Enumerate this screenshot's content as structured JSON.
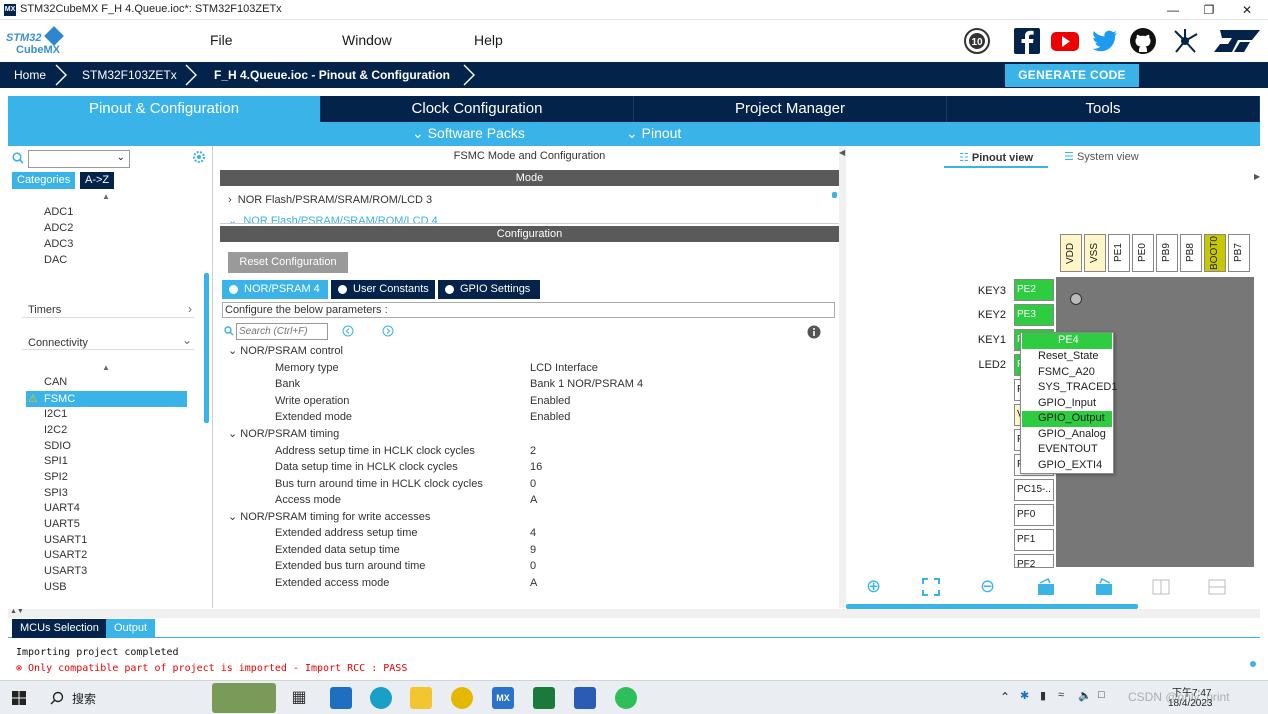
{
  "window": {
    "title": "STM32CubeMX F_H 4.Queue.ioc*: STM32F103ZETx",
    "app_icon": "MX",
    "controls": [
      "—",
      "❐",
      "✕"
    ]
  },
  "menubar": {
    "logo_line1": "STM32",
    "logo_line2": "CubeMX",
    "items": [
      "File",
      "Window",
      "Help"
    ],
    "badge": "10",
    "social_icons": [
      "anniversary-badge-icon",
      "facebook-icon",
      "youtube-icon",
      "twitter-icon",
      "github-icon",
      "network-icon",
      "st-logo-icon"
    ]
  },
  "breadcrumb": {
    "items": [
      "Home",
      "STM32F103ZETx",
      "F_H 4.Queue.ioc - Pinout & Configuration"
    ],
    "generate_label": "GENERATE CODE"
  },
  "main_tabs": [
    "Pinout & Configuration",
    "Clock Configuration",
    "Project Manager",
    "Tools"
  ],
  "sub_tabs": [
    "Software Packs",
    "Pinout"
  ],
  "left_panel": {
    "category_tabs": [
      "Categories",
      "A->Z"
    ],
    "analog_items": [
      "ADC1",
      "ADC2",
      "ADC3",
      "DAC"
    ],
    "timers_label": "Timers",
    "connectivity_label": "Connectivity",
    "connectivity_items": [
      "CAN",
      "FSMC",
      "I2C1",
      "I2C2",
      "SDIO",
      "SPI1",
      "SPI2",
      "SPI3",
      "UART4",
      "UART5",
      "USART1",
      "USART2",
      "USART3",
      "USB"
    ],
    "selected": "FSMC"
  },
  "center": {
    "title": "FSMC Mode and Configuration",
    "mode_header": "Mode",
    "mode_rows": [
      "NOR Flash/PSRAM/SRAM/ROM/LCD 3",
      "NOR Flash/PSRAM/SRAM/ROM/LCD 4"
    ],
    "config_header": "Configuration",
    "reset_button": "Reset Configuration",
    "config_tabs": [
      "NOR/PSRAM 4",
      "User Constants",
      "GPIO Settings"
    ],
    "params_hint": "Configure the below parameters :",
    "search_placeholder": "Search (Ctrl+F)",
    "groups": [
      {
        "name": "NOR/PSRAM control",
        "params": [
          {
            "k": "Memory type",
            "v": "LCD Interface"
          },
          {
            "k": "Bank",
            "v": "Bank 1 NOR/PSRAM 4"
          },
          {
            "k": "Write operation",
            "v": "Enabled"
          },
          {
            "k": "Extended mode",
            "v": "Enabled"
          }
        ]
      },
      {
        "name": "NOR/PSRAM timing",
        "params": [
          {
            "k": "Address setup time in HCLK clock cycles",
            "v": "2"
          },
          {
            "k": "Data setup time in HCLK clock cycles",
            "v": "16"
          },
          {
            "k": "Bus turn around time in HCLK clock cycles",
            "v": "0"
          },
          {
            "k": "Access mode",
            "v": "A"
          }
        ]
      },
      {
        "name": "NOR/PSRAM timing for write accesses",
        "params": [
          {
            "k": "Extended address setup time",
            "v": "4"
          },
          {
            "k": "Extended data setup time",
            "v": "9"
          },
          {
            "k": "Extended bus turn around time",
            "v": "0"
          },
          {
            "k": "Extended access mode",
            "v": "A"
          }
        ]
      }
    ]
  },
  "right": {
    "tabs": [
      "Pinout view",
      "System view"
    ],
    "top_pins": [
      "VDD",
      "VSS",
      "PE1",
      "PE0",
      "PB9",
      "PB8",
      "BOOT0",
      "PB7"
    ],
    "left_pins": [
      "PE2",
      "PE3",
      "P",
      "P",
      "P",
      "V",
      "P",
      "P",
      "P",
      "PC15-..",
      "PF0",
      "PF1",
      "PF2"
    ],
    "pin_labels": [
      "KEY3",
      "KEY2",
      "KEY1",
      "LED2"
    ],
    "context_menu": {
      "title": "PE4",
      "items": [
        "Reset_State",
        "FSMC_A20",
        "SYS_TRACED1",
        "GPIO_Input",
        "GPIO_Output",
        "GPIO_Analog",
        "EVENTOUT",
        "GPIO_EXTI4"
      ],
      "highlighted": "GPIO_Output"
    },
    "tool_icons": [
      "zoom-in-icon",
      "fit-icon",
      "zoom-out-icon",
      "rotate-right-icon",
      "rotate-left-icon",
      "split-icon",
      "list-icon"
    ]
  },
  "bottom": {
    "tabs": [
      "MCUs Selection",
      "Output"
    ],
    "lines": [
      "Importing project completed",
      "⊗ Only compatible part of project is imported - Import RCC : PASS"
    ]
  },
  "taskbar": {
    "search_label": "搜索",
    "time": "下午7:47",
    "date": "18/4/2023",
    "watermark": "CSDN @only_print"
  },
  "colors": {
    "navy": "#03234b",
    "accent": "#3ab3e9",
    "pin_green": "#2ecc40",
    "pin_yellow": "#fff6c8"
  }
}
